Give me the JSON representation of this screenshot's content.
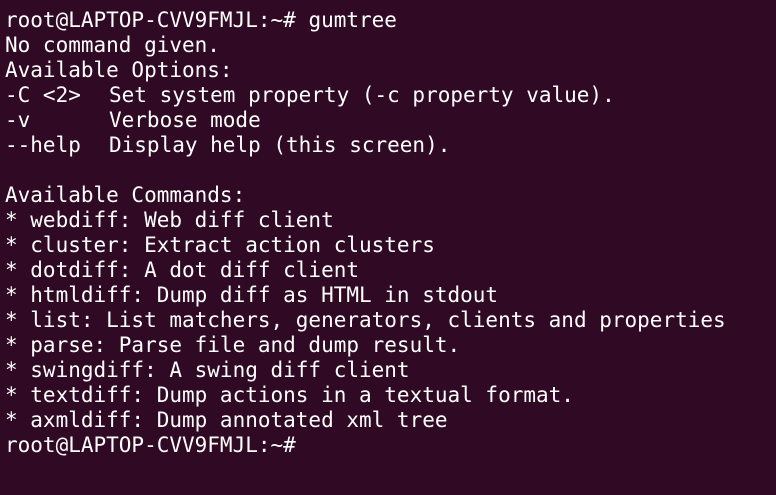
{
  "terminal": {
    "prompt": "root@LAPTOP-CVV9FMJL:~#",
    "command": " gumtree",
    "message": "No command given.",
    "options_heading": "Available Options:",
    "options": [
      {
        "flag": "-C <2>",
        "desc": "Set system property (-c property value)."
      },
      {
        "flag": "-v",
        "desc": "Verbose mode"
      },
      {
        "flag": "--help",
        "desc": "Display help (this screen)."
      }
    ],
    "commands_heading": "Available Commands:",
    "commands": [
      "* webdiff: Web diff client",
      "* cluster: Extract action clusters",
      "* dotdiff: A dot diff client",
      "* htmldiff: Dump diff as HTML in stdout",
      "* list: List matchers, generators, clients and properties",
      "* parse: Parse file and dump result.",
      "* swingdiff: A swing diff client",
      "* textdiff: Dump actions in a textual format.",
      "* axmldiff: Dump annotated xml tree"
    ],
    "final_prompt": "root@LAPTOP-CVV9FMJL:~#"
  }
}
